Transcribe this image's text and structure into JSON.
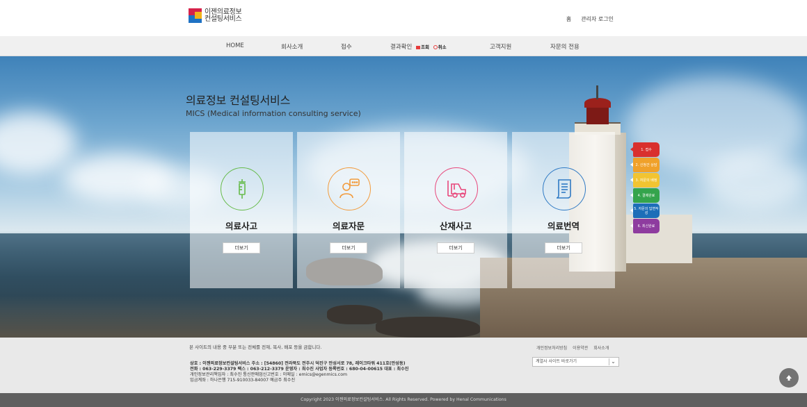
{
  "brand": {
    "logo_line1": "이젠의료정보",
    "logo_line2": "컨설팅서비스"
  },
  "top_links": {
    "home": "홈",
    "admin_login": "관리자 로그인"
  },
  "nav": {
    "home": "HOME",
    "about": "회사소개",
    "apply": "접수",
    "result": "결과확인",
    "result_view": "조회",
    "result_cancel": "취소",
    "support": "고객지원",
    "exclusive": "자문의 전용"
  },
  "hero": {
    "title_ko": "의료정보 컨설팅서비스",
    "title_en": "MICS (Medical information consulting service)"
  },
  "services": [
    {
      "name": "의료사고",
      "button": "더보기",
      "icon": "syringe-icon",
      "color": "#66bb4a"
    },
    {
      "name": "의료자문",
      "button": "더보기",
      "icon": "consultant-icon",
      "color": "#f29b3c"
    },
    {
      "name": "산재사고",
      "button": "더보기",
      "icon": "forklift-icon",
      "color": "#e8467b"
    },
    {
      "name": "의료번역",
      "button": "더보기",
      "icon": "document-icon",
      "color": "#2f7ac4"
    }
  ],
  "steps": [
    {
      "label": "1. 접수",
      "color": "#d9302e"
    },
    {
      "label": "2. 신청건 상담",
      "color": "#f0a12a"
    },
    {
      "label": "3. 자문의 배정",
      "color": "#f2c431"
    },
    {
      "label": "4. 결제완료",
      "color": "#34a44c"
    },
    {
      "label": "5. 자문의 답변작성",
      "color": "#1d6eb8"
    },
    {
      "label": "6. 최신완료",
      "color": "#8e3c9f"
    }
  ],
  "footer": {
    "notice": "본 사이트의 내용 중 부분 또는 전체를 전재, 복사, 배포 등을 금합니다.",
    "links": [
      "개인정보처리방침",
      "이용약관",
      "회사소개"
    ],
    "family_site": "계열사 사이트 바로가기",
    "line1": "상호 : 이젠의료정보컨설팅서비스    주소 : [54860] 전라북도 전주시 덕진구 만성서로 78, 레이크타워 411호(만성동)",
    "line2": "전화 : 063-229-3379    팩스 : 063-212-3379    운영자 : 최수진    사업자 등록번호 : 680-04-00615    대표 : 최수진",
    "line3": "개인정보관리책임자 : 최수진    통신판매업신고번호 :    이메일 : emics@egenmics.com",
    "line4": "입금계좌 : 하나은행 715-910033-84007 예금주 최수진",
    "copyright": "Copyright 2023 이젠의료정보컨설팅서비스. All Rights Reserved. Powered by Henal Communications"
  }
}
